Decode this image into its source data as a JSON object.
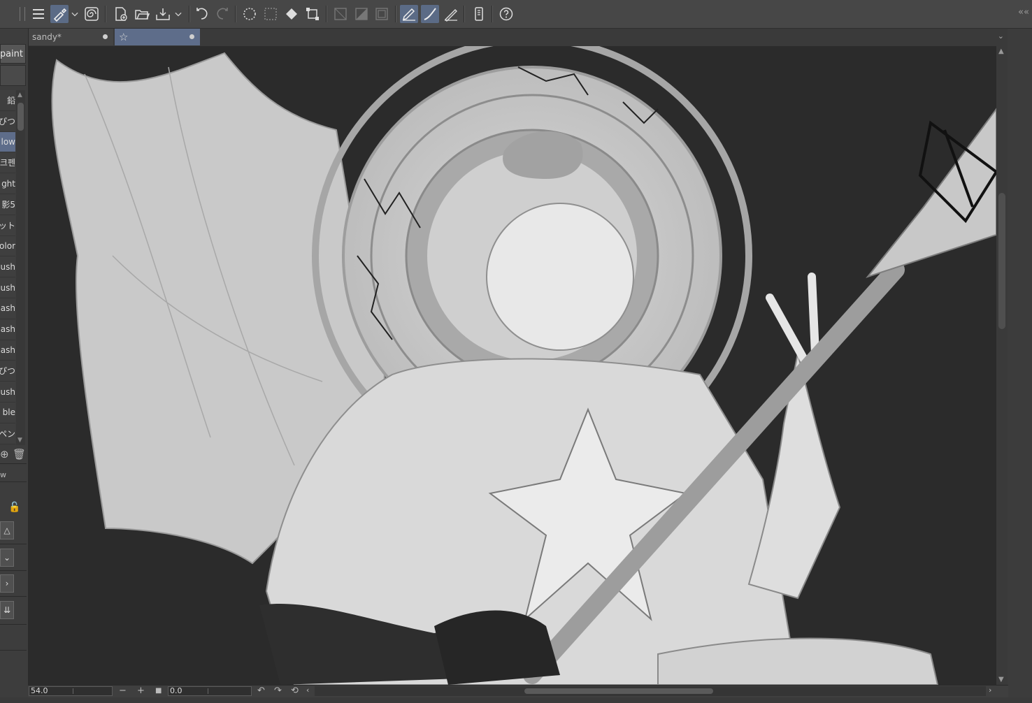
{
  "toolbar": {
    "icons": [
      "menu-icon",
      "brush-tool-icon",
      "dropdown-icon",
      "spiral-icon",
      "new-file-icon",
      "open-folder-icon",
      "save-export-icon",
      "dropdown-icon",
      "undo-icon",
      "redo-icon",
      "select-all-icon",
      "deselect-icon",
      "fill-icon",
      "transform-icon",
      "hatch-icon",
      "gradient-icon",
      "frame-icon",
      "pen-pressure-icon",
      "stroke-icon",
      "ruler-icon",
      "device-icon",
      "help-icon"
    ]
  },
  "tabs": [
    {
      "label": "sandy*"
    },
    {
      "label": "☆"
    }
  ],
  "left_panel": {
    "paint_label": "paint",
    "brushes": [
      "鉛",
      "ぴつ",
      "low",
      "크펜",
      "ght",
      "影5",
      "ット",
      "olor",
      "ush",
      "ush",
      "ash",
      "ash",
      "ash",
      "ぴつ",
      "ush",
      "ble",
      "ペン"
    ],
    "selected_index": 2,
    "w_label": "w"
  },
  "status": {
    "zoom_value": "54.0",
    "rotate_value": "0.0"
  },
  "colors": {
    "accent": "#5e6d8a",
    "panel": "#3d3d3d",
    "canvas_bg": "#2b2b2b"
  }
}
